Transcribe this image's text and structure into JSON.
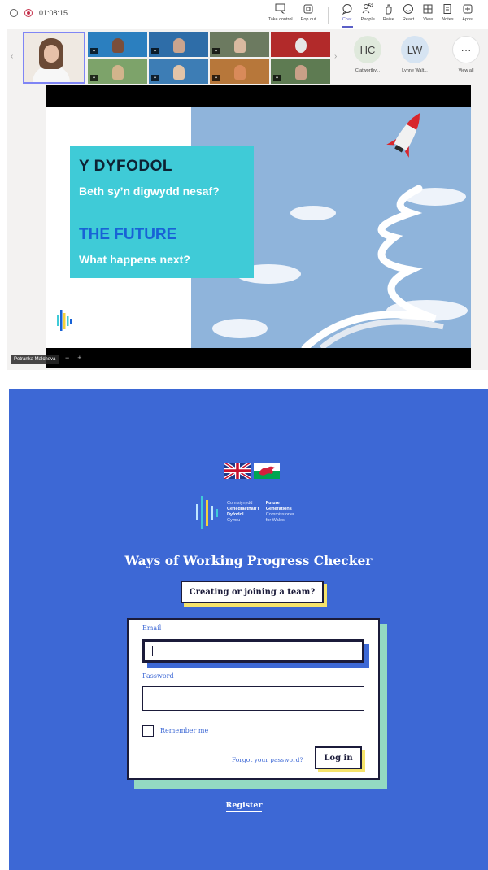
{
  "meeting": {
    "timer": "01:08:15",
    "toolbar": [
      {
        "label": "Take control",
        "icon": "take-control-icon"
      },
      {
        "label": "Pop out",
        "icon": "pop-out-icon"
      },
      {
        "label": "Chat",
        "icon": "chat-icon"
      },
      {
        "label": "People",
        "icon": "people-icon"
      },
      {
        "label": "Raise",
        "icon": "raise-hand-icon"
      },
      {
        "label": "React",
        "icon": "react-icon"
      },
      {
        "label": "View",
        "icon": "view-icon"
      },
      {
        "label": "Notes",
        "icon": "notes-icon"
      },
      {
        "label": "Apps",
        "icon": "apps-icon"
      }
    ],
    "people_count": "52",
    "roster": [
      {
        "initials": "HC",
        "name": "Clatworthy...",
        "color": "#dfe9dc"
      },
      {
        "initials": "LW",
        "name": "Lynne Walt...",
        "color": "#d6e4f2"
      },
      {
        "initials": "···",
        "name": "View all",
        "color": "#ffffff"
      }
    ],
    "presenter_name": "Petranka Malcheva",
    "slide": {
      "line1": "Y DYFODOL",
      "line2": "Beth sy’n digwydd nesaf?",
      "line3": "THE FUTURE",
      "line4": "What happens next?"
    },
    "accent": "#5b5fc7"
  },
  "login": {
    "brand_welsh": [
      "Comisiynydd",
      "Cenedlaethau’r",
      "Dyfodol",
      "Cymru"
    ],
    "brand_english": [
      "Future",
      "Generations",
      "Commissioner",
      "for Wales"
    ],
    "title": "Ways of Working Progress Checker",
    "team_button": "Creating or joining a team?",
    "email_label": "Email",
    "email_value": "",
    "password_label": "Password",
    "remember_label": "Remember me",
    "forgot_link": "Forgot your password?",
    "login_button": "Log in",
    "register_link": "Register",
    "colors": {
      "background": "#3d68d5",
      "yellow_shadow": "#f5e36b",
      "green_shadow": "#93d9c2",
      "ink": "#1b1b3a"
    }
  }
}
